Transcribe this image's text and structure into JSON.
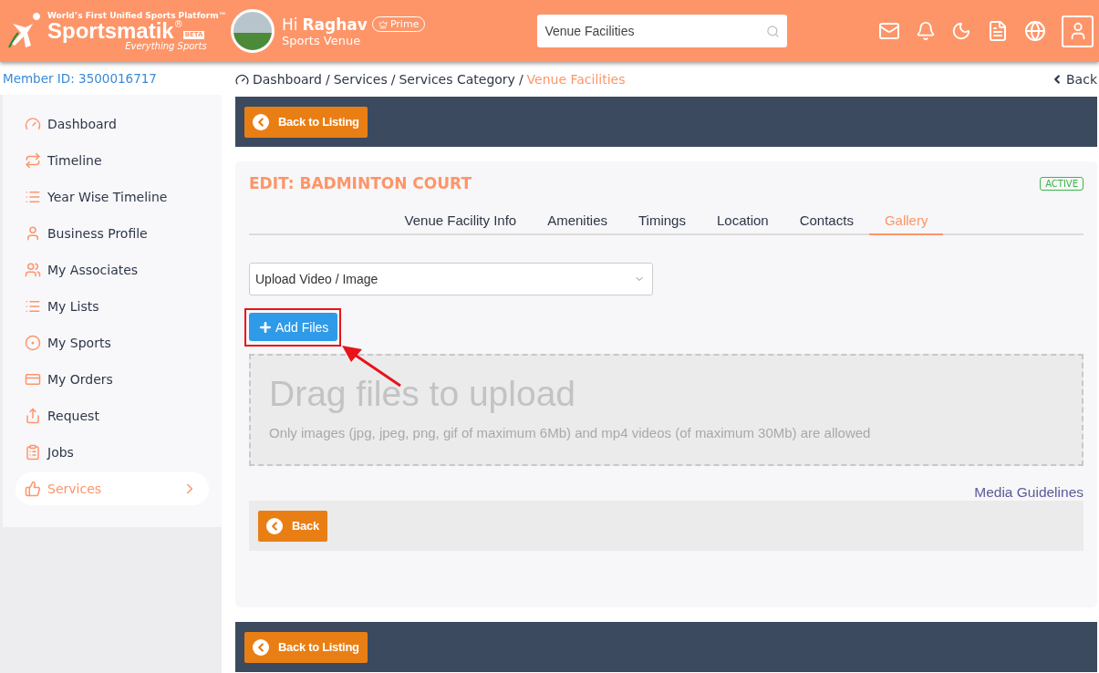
{
  "header": {
    "tagline": "World’s First Unified Sports Platform™",
    "brand": "Sportsmatik",
    "registered": "®",
    "beta": "BETA",
    "slogan": "Everything Sports",
    "greeting": "Hi",
    "user": "Raghav",
    "badge": "Prime",
    "role": "Sports Venue",
    "search": {
      "value": "Venue Facilities"
    }
  },
  "member_id": "Member ID: 3500016717",
  "breadcrumb": [
    "Dashboard",
    "Services",
    "Services Category",
    "Venue Facilities"
  ],
  "breadcrumb_separator": "/",
  "back_link": "Back",
  "sidebar": {
    "items": [
      {
        "label": "Dashboard",
        "selected": false
      },
      {
        "label": "Timeline",
        "selected": false
      },
      {
        "label": "Year Wise Timeline",
        "selected": false
      },
      {
        "label": "Business Profile",
        "selected": false
      },
      {
        "label": "My Associates",
        "selected": false
      },
      {
        "label": "My Lists",
        "selected": false
      },
      {
        "label": "My Sports",
        "selected": false
      },
      {
        "label": "My Orders",
        "selected": false
      },
      {
        "label": "Request",
        "selected": false
      },
      {
        "label": "Jobs",
        "selected": false
      },
      {
        "label": "Services",
        "selected": true
      }
    ]
  },
  "top_bar": {
    "button": "Back to Listing"
  },
  "card": {
    "title": "EDIT: BADMINTON COURT",
    "status": "ACTIVE",
    "tabs": [
      {
        "label": "Venue Facility Info",
        "selected": false
      },
      {
        "label": "Amenities",
        "selected": false
      },
      {
        "label": "Timings",
        "selected": false
      },
      {
        "label": "Location",
        "selected": false
      },
      {
        "label": "Contacts",
        "selected": false
      },
      {
        "label": "Gallery",
        "selected": true
      }
    ],
    "select": {
      "value": "Upload Video / Image"
    },
    "add_button": "Add Files",
    "dropzone": {
      "title": "Drag files to upload",
      "hint": "Only images (jpg, jpeg, png, gif of maximum 6Mb) and mp4 videos (of maximum 30Mb) are allowed"
    },
    "guidelines_link": "Media Guidelines",
    "back_button": "Back"
  },
  "bottom_bar": {
    "button": "Back to Listing"
  }
}
